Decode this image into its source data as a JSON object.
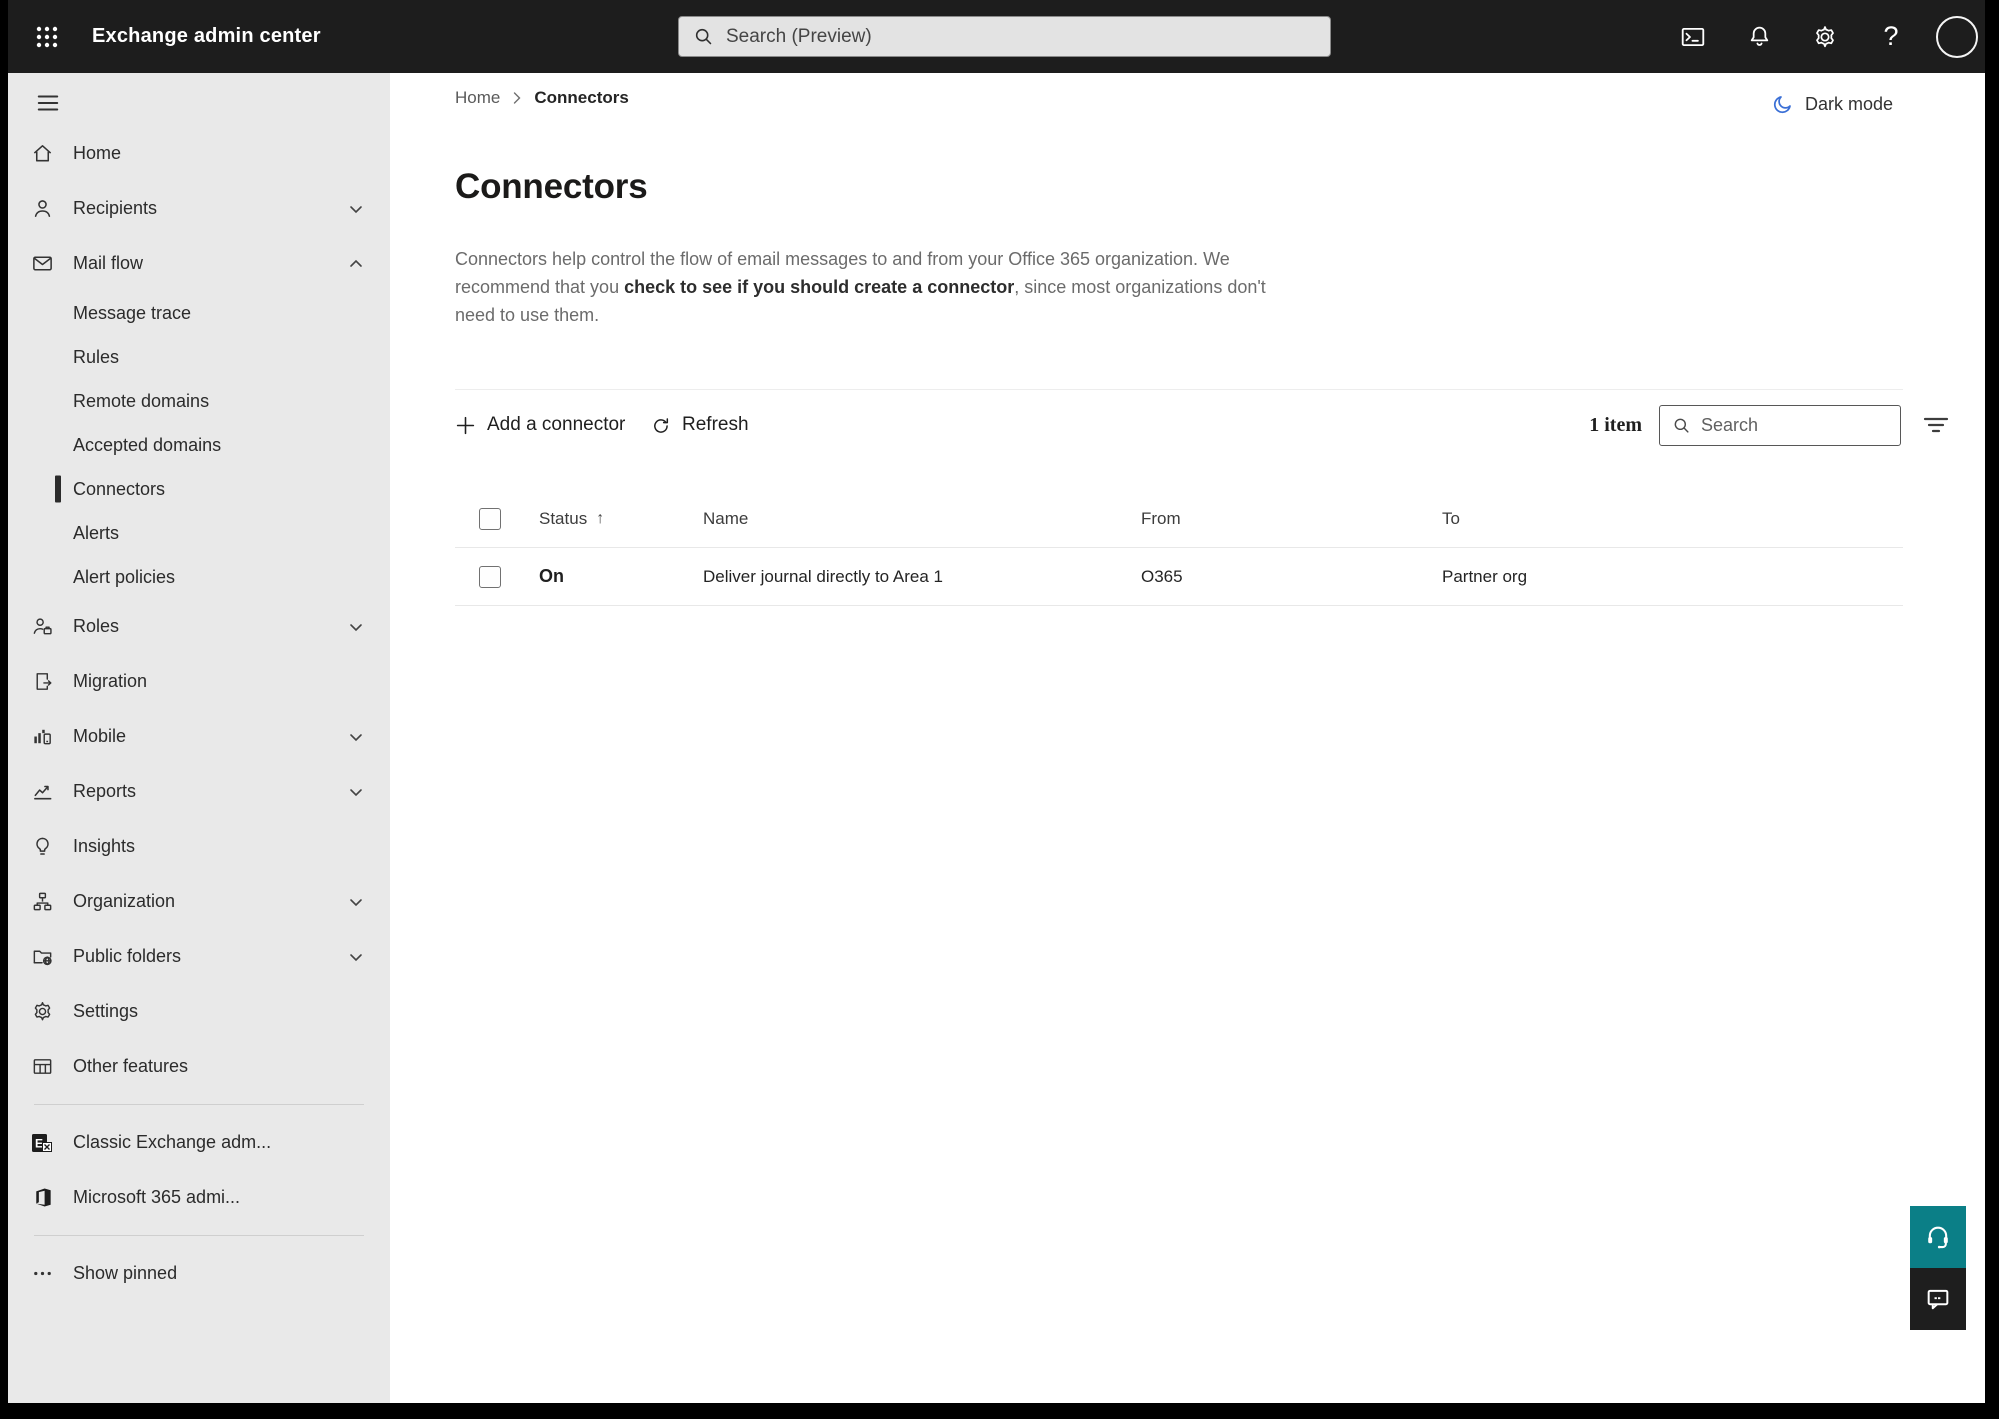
{
  "colors": {
    "topbar_bg": "#1d1d1d",
    "sidebar_bg": "#e9e9e9",
    "selected_marker": "#2b2b2b",
    "moon_blue": "#3a6fd6",
    "help_button_teal": "#0b7f87",
    "feedback_button_dark": "#1e1e1e"
  },
  "icons": {
    "help_glyph": "?",
    "sort_asc": "↑",
    "exchange_e": "E"
  },
  "topbar": {
    "title": "Exchange admin center",
    "search_placeholder": "Search (Preview)"
  },
  "sidebar": {
    "home": "Home",
    "recipients": "Recipients",
    "mail_flow": "Mail flow",
    "message_trace": "Message trace",
    "rules": "Rules",
    "remote_domains": "Remote domains",
    "accepted_domains": "Accepted domains",
    "connectors": "Connectors",
    "alerts": "Alerts",
    "alert_policies": "Alert policies",
    "roles": "Roles",
    "migration": "Migration",
    "mobile": "Mobile",
    "reports": "Reports",
    "insights": "Insights",
    "organization": "Organization",
    "public_folders": "Public folders",
    "settings": "Settings",
    "other_features": "Other features",
    "classic_exchange": "Classic Exchange adm...",
    "m365_admin": "Microsoft 365 admi...",
    "show_pinned": "Show pinned"
  },
  "main": {
    "breadcrumb": {
      "home": "Home",
      "current": "Connectors"
    },
    "dark_mode_label": "Dark mode",
    "title": "Connectors",
    "description": {
      "before_link": "Connectors help control the flow of email messages to and from your Office 365 organization. We recommend that you ",
      "link": "check to see if you should create a connector",
      "after_link": ", since most organizations don't need to use them."
    },
    "toolbar": {
      "add_label": "Add a connector",
      "refresh_label": "Refresh",
      "item_count": "1 item",
      "search_placeholder": "Search"
    },
    "table": {
      "headers": {
        "status": "Status",
        "name": "Name",
        "from": "From",
        "to": "To"
      },
      "rows": [
        {
          "status": "On",
          "name": "Deliver journal directly to Area 1",
          "from": "O365",
          "to": "Partner org"
        }
      ]
    }
  }
}
